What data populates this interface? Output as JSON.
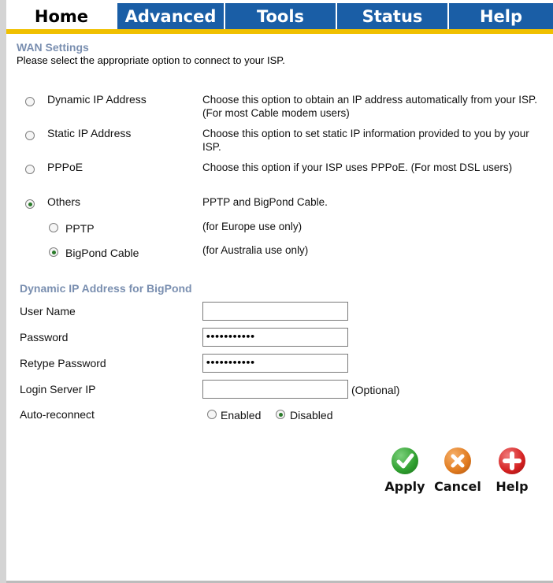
{
  "tabs": [
    {
      "label": "Home",
      "active": true
    },
    {
      "label": "Advanced",
      "active": false
    },
    {
      "label": "Tools",
      "active": false
    },
    {
      "label": "Status",
      "active": false
    },
    {
      "label": "Help",
      "active": false
    }
  ],
  "wan": {
    "title": "WAN Settings",
    "subtitle": "Please select the appropriate option to connect to your ISP.",
    "options": [
      {
        "label": "Dynamic IP Address",
        "desc": "Choose this option to obtain an IP address automatically from your ISP. (For most Cable modem users)",
        "selected": false
      },
      {
        "label": "Static IP Address",
        "desc": "Choose this option to set static IP information provided to you by your ISP.",
        "selected": false
      },
      {
        "label": "PPPoE",
        "desc": "Choose this option if your ISP uses PPPoE. (For most DSL users)",
        "selected": false
      },
      {
        "label": "Others",
        "desc": "PPTP and BigPond Cable.",
        "selected": true
      }
    ],
    "sub_options": [
      {
        "label": "PPTP",
        "desc": "(for Europe use only)",
        "selected": false
      },
      {
        "label": "BigPond Cable",
        "desc": "(for Australia use only)",
        "selected": true
      }
    ]
  },
  "bigpond": {
    "title": "Dynamic IP Address for BigPond",
    "user_name_label": "User Name",
    "user_name_value": "",
    "password_label": "Password",
    "password_value": "•••••••••••",
    "retype_label": "Retype Password",
    "retype_value": "•••••••••••",
    "login_server_label": "Login Server IP",
    "login_server_value": "",
    "login_server_note": "(Optional)",
    "auto_reconnect_label": "Auto-reconnect",
    "enabled_label": "Enabled",
    "disabled_label": "Disabled",
    "auto_reconnect_value": "Disabled"
  },
  "actions": {
    "apply_label": "Apply",
    "cancel_label": "Cancel",
    "help_label": "Help"
  },
  "colors": {
    "tab_blue": "#1a5ea6",
    "tab_underline": "#f0c000",
    "section_title": "#7a8fb0",
    "apply_green": "#2e9e2e",
    "cancel_orange": "#e07a1e",
    "help_red": "#d42020"
  }
}
